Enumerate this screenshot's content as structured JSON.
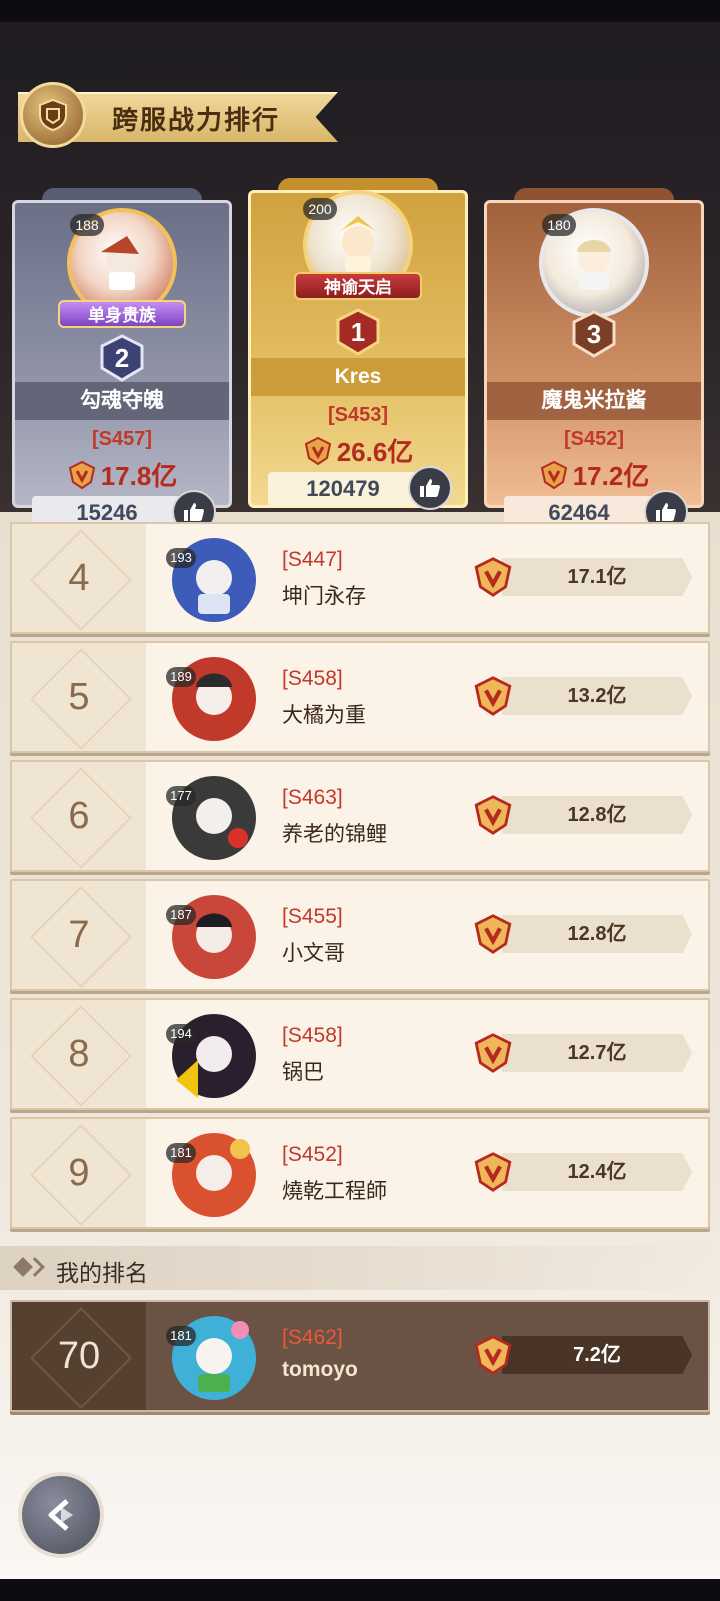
{
  "title": "跨服战力排行",
  "podium": [
    {
      "rank": "2",
      "level": "188",
      "badge": "单身贵族",
      "name": "勾魂夺魄",
      "server": "[S457]",
      "power": "17.8亿",
      "likes": "15246"
    },
    {
      "rank": "1",
      "level": "200",
      "badge": "神谕天启",
      "name": "Kres",
      "server": "[S453]",
      "power": "26.6亿",
      "likes": "120479"
    },
    {
      "rank": "3",
      "level": "180",
      "badge": "",
      "name": "魔鬼米拉酱",
      "server": "[S452]",
      "power": "17.2亿",
      "likes": "62464"
    }
  ],
  "rows": [
    {
      "rank": "4",
      "level": "193",
      "server": "[S447]",
      "name": "坤门永存",
      "power": "17.1亿"
    },
    {
      "rank": "5",
      "level": "189",
      "server": "[S458]",
      "name": "大橘为重",
      "power": "13.2亿"
    },
    {
      "rank": "6",
      "level": "177",
      "server": "[S463]",
      "name": "养老的锦鲤",
      "power": "12.8亿"
    },
    {
      "rank": "7",
      "level": "187",
      "server": "[S455]",
      "name": "小文哥",
      "power": "12.8亿"
    },
    {
      "rank": "8",
      "level": "194",
      "server": "[S458]",
      "name": "锅巴",
      "power": "12.7亿"
    },
    {
      "rank": "9",
      "level": "181",
      "server": "[S452]",
      "name": "燒乾工程師",
      "power": "12.4亿"
    }
  ],
  "my_rank_label": "我的排名",
  "my": {
    "rank": "70",
    "level": "181",
    "server": "[S462]",
    "name": "tomoyo",
    "power": "7.2亿"
  },
  "colors": {
    "server_red": "#c0392b",
    "gold": "#e3bd60",
    "silver": "#8e91a6",
    "bronze": "#cc8d63"
  },
  "icons": {
    "title": "shield-icon",
    "power": "power-crest-icon",
    "like": "thumbs-up-icon",
    "back": "back-arrow-icon"
  }
}
